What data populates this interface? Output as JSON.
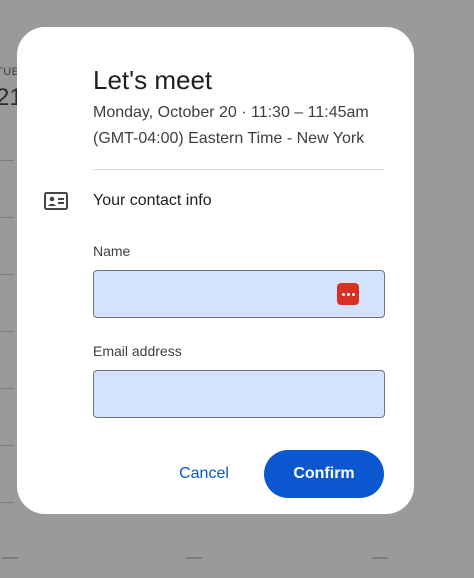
{
  "background": {
    "day_label": "TUE",
    "day_number": "21"
  },
  "dialog": {
    "title": "Let's meet",
    "datetime": "Monday, October 20 · 11:30 – 11:45am",
    "timezone": "(GMT-04:00) Eastern Time - New York",
    "contact_section_title": "Your contact info",
    "contact_icon": "contact-card-icon",
    "fields": {
      "name": {
        "label": "Name",
        "value": "",
        "trailing_icon": "password-manager-icon"
      },
      "email": {
        "label": "Email address",
        "value": ""
      }
    },
    "cancel_label": "Cancel",
    "confirm_label": "Confirm"
  },
  "colors": {
    "accent": "#0b57d0",
    "field_fill": "#d3e3fd",
    "password_icon": "#d93025",
    "backdrop": "#9a9a9a"
  }
}
